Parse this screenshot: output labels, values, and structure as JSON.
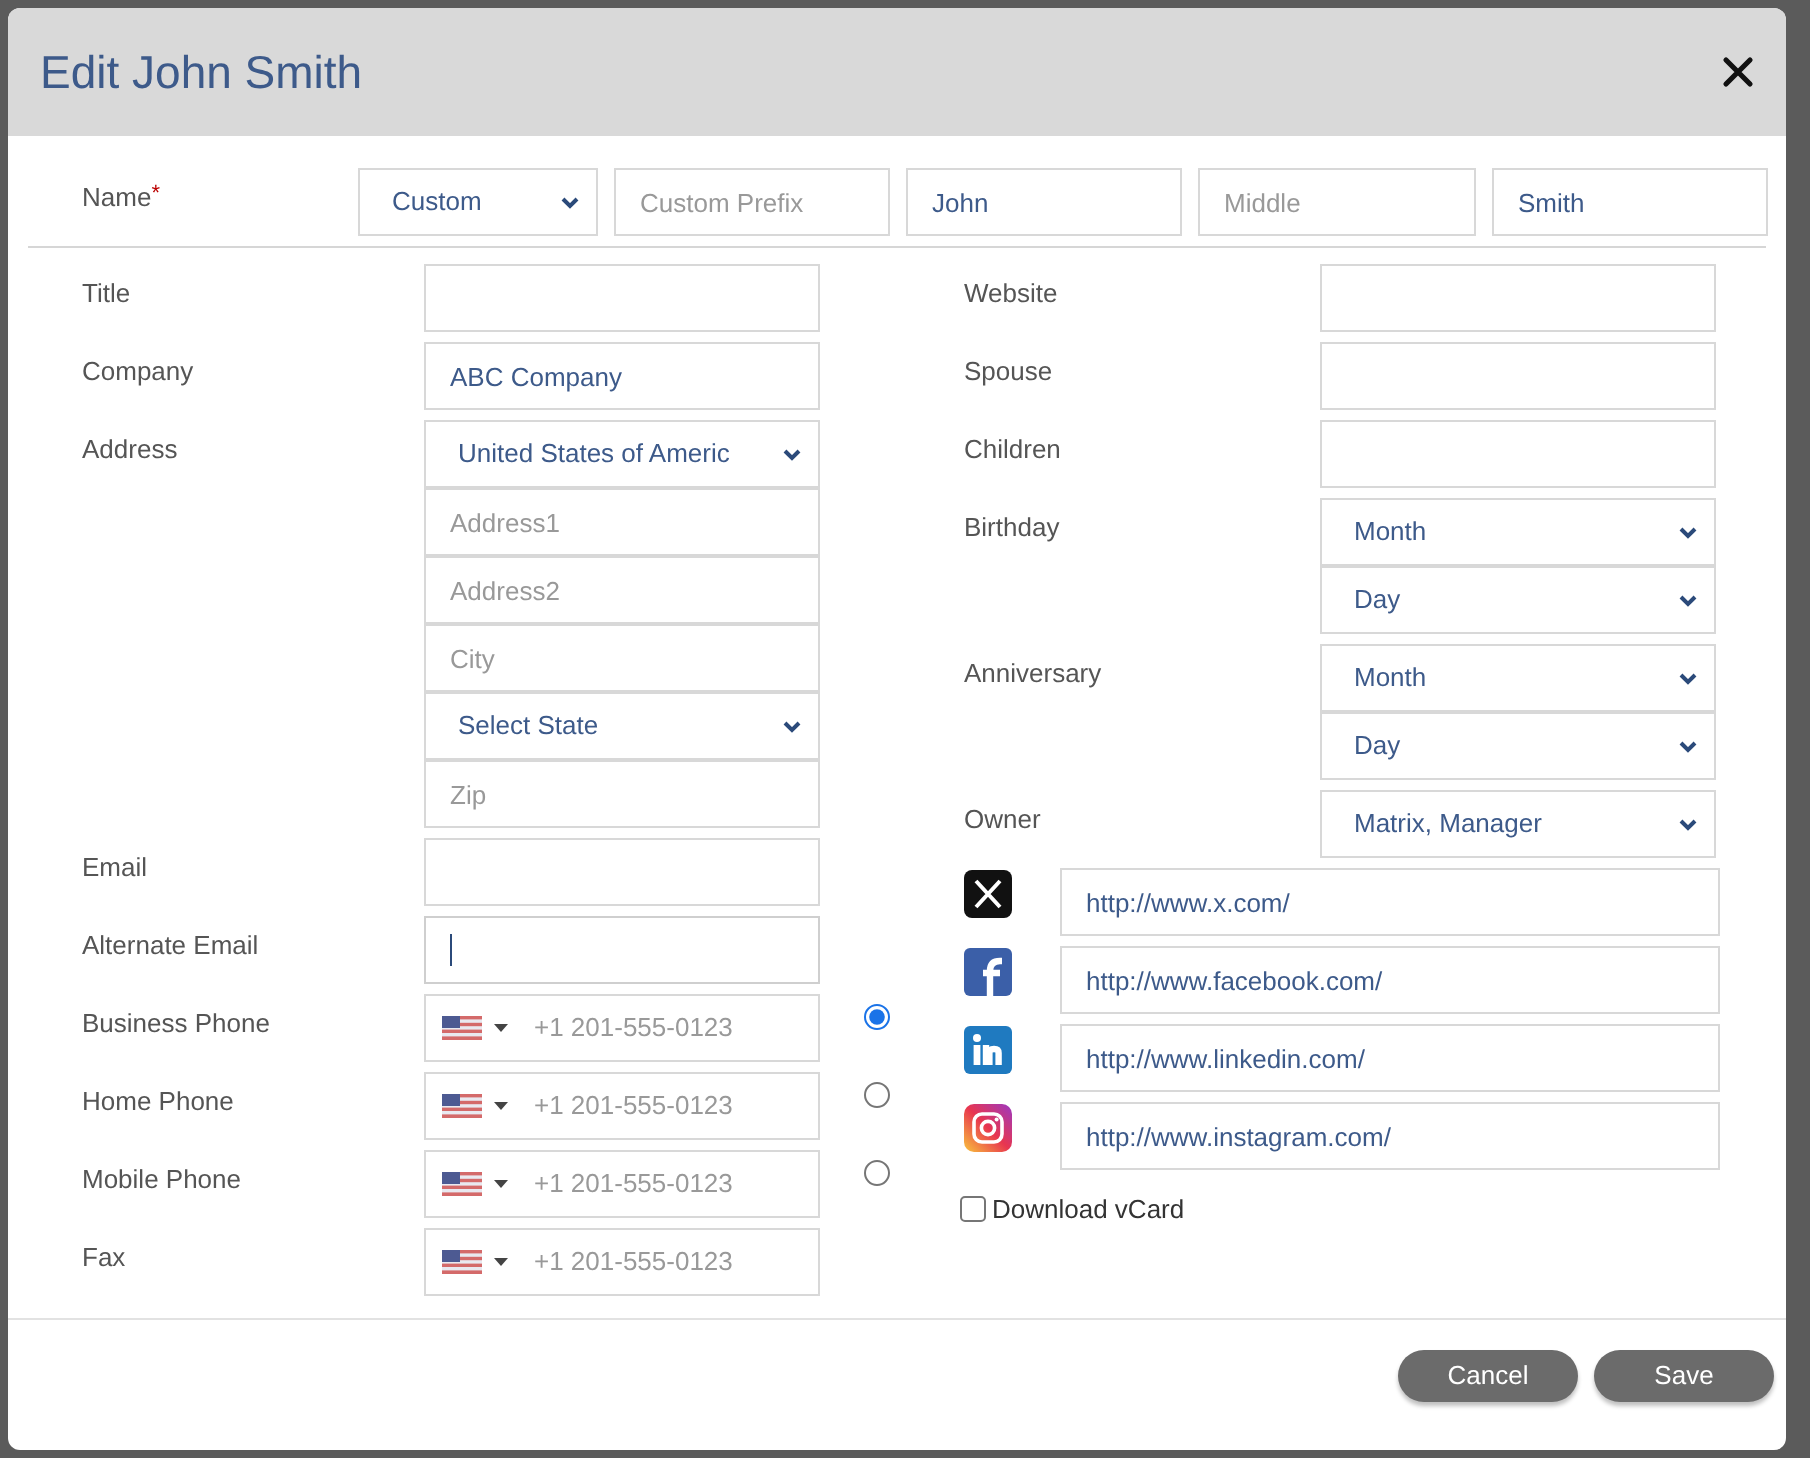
{
  "dialog": {
    "title": "Edit John Smith"
  },
  "name": {
    "label": "Name",
    "required_mark": "*",
    "controls": [
      {
        "kind": "select",
        "value": "Custom"
      },
      {
        "kind": "input",
        "placeholder": "Custom Prefix",
        "focused": false
      },
      {
        "kind": "input",
        "value": "John",
        "focused": false
      },
      {
        "kind": "input",
        "placeholder": "Middle",
        "focused": false
      },
      {
        "kind": "input",
        "value": "Smith",
        "focused": false
      }
    ]
  },
  "left_fields": [
    {
      "label": "Title",
      "controls": [
        {
          "kind": "input",
          "focused": false
        }
      ]
    },
    {
      "label": "Company",
      "controls": [
        {
          "kind": "input",
          "value": "ABC Company",
          "focused": false
        }
      ]
    },
    {
      "label": "Address",
      "controls": [
        {
          "kind": "select",
          "value": "United States of Americ"
        },
        {
          "kind": "input",
          "placeholder": "Address1",
          "focused": false
        },
        {
          "kind": "input",
          "placeholder": "Address2",
          "focused": false
        },
        {
          "kind": "input",
          "placeholder": "City",
          "focused": false
        },
        {
          "kind": "select",
          "value": "Select State"
        },
        {
          "kind": "input",
          "placeholder": "Zip",
          "focused": false
        }
      ]
    },
    {
      "label": "Email",
      "controls": [
        {
          "kind": "input",
          "focused": false
        }
      ]
    },
    {
      "label": "Alternate Email",
      "controls": [
        {
          "kind": "input",
          "focused": true
        }
      ]
    },
    {
      "label": "Business Phone",
      "controls": [
        {
          "kind": "phone",
          "placeholder": "+1 201-555-0123"
        }
      ],
      "primary": {
        "selected": true
      }
    },
    {
      "label": "Home Phone",
      "controls": [
        {
          "kind": "phone",
          "placeholder": "+1 201-555-0123"
        }
      ],
      "primary": {
        "selected": false
      }
    },
    {
      "label": "Mobile Phone",
      "controls": [
        {
          "kind": "phone",
          "placeholder": "+1 201-555-0123"
        }
      ],
      "primary": {
        "selected": false
      }
    },
    {
      "label": "Fax",
      "controls": [
        {
          "kind": "phone",
          "placeholder": "+1 201-555-0123"
        }
      ]
    }
  ],
  "right_fields": [
    {
      "label": "Website",
      "controls": [
        {
          "kind": "input",
          "focused": false
        }
      ]
    },
    {
      "label": "Spouse",
      "controls": [
        {
          "kind": "input",
          "focused": false
        }
      ]
    },
    {
      "label": "Children",
      "controls": [
        {
          "kind": "input",
          "focused": false
        }
      ]
    },
    {
      "label": "Birthday",
      "controls": [
        {
          "kind": "select",
          "value": "Month"
        },
        {
          "kind": "select",
          "value": "Day"
        }
      ]
    },
    {
      "label": "Anniversary",
      "controls": [
        {
          "kind": "select",
          "value": "Month"
        },
        {
          "kind": "select",
          "value": "Day"
        }
      ]
    },
    {
      "label": "Owner",
      "controls": [
        {
          "kind": "select",
          "value": "Matrix, Manager"
        }
      ]
    }
  ],
  "social_links": [
    {
      "kind": "x",
      "value": "http://www.x.com/"
    },
    {
      "kind": "facebook",
      "value": "http://www.facebook.com/"
    },
    {
      "kind": "linkedin",
      "value": "http://www.linkedin.com/"
    },
    {
      "kind": "instagram",
      "value": "http://www.instagram.com/"
    }
  ],
  "vcard": {
    "label": "Download vCard",
    "checked": false
  },
  "buttons": [
    {
      "label": "Cancel"
    },
    {
      "label": "Save"
    }
  ]
}
